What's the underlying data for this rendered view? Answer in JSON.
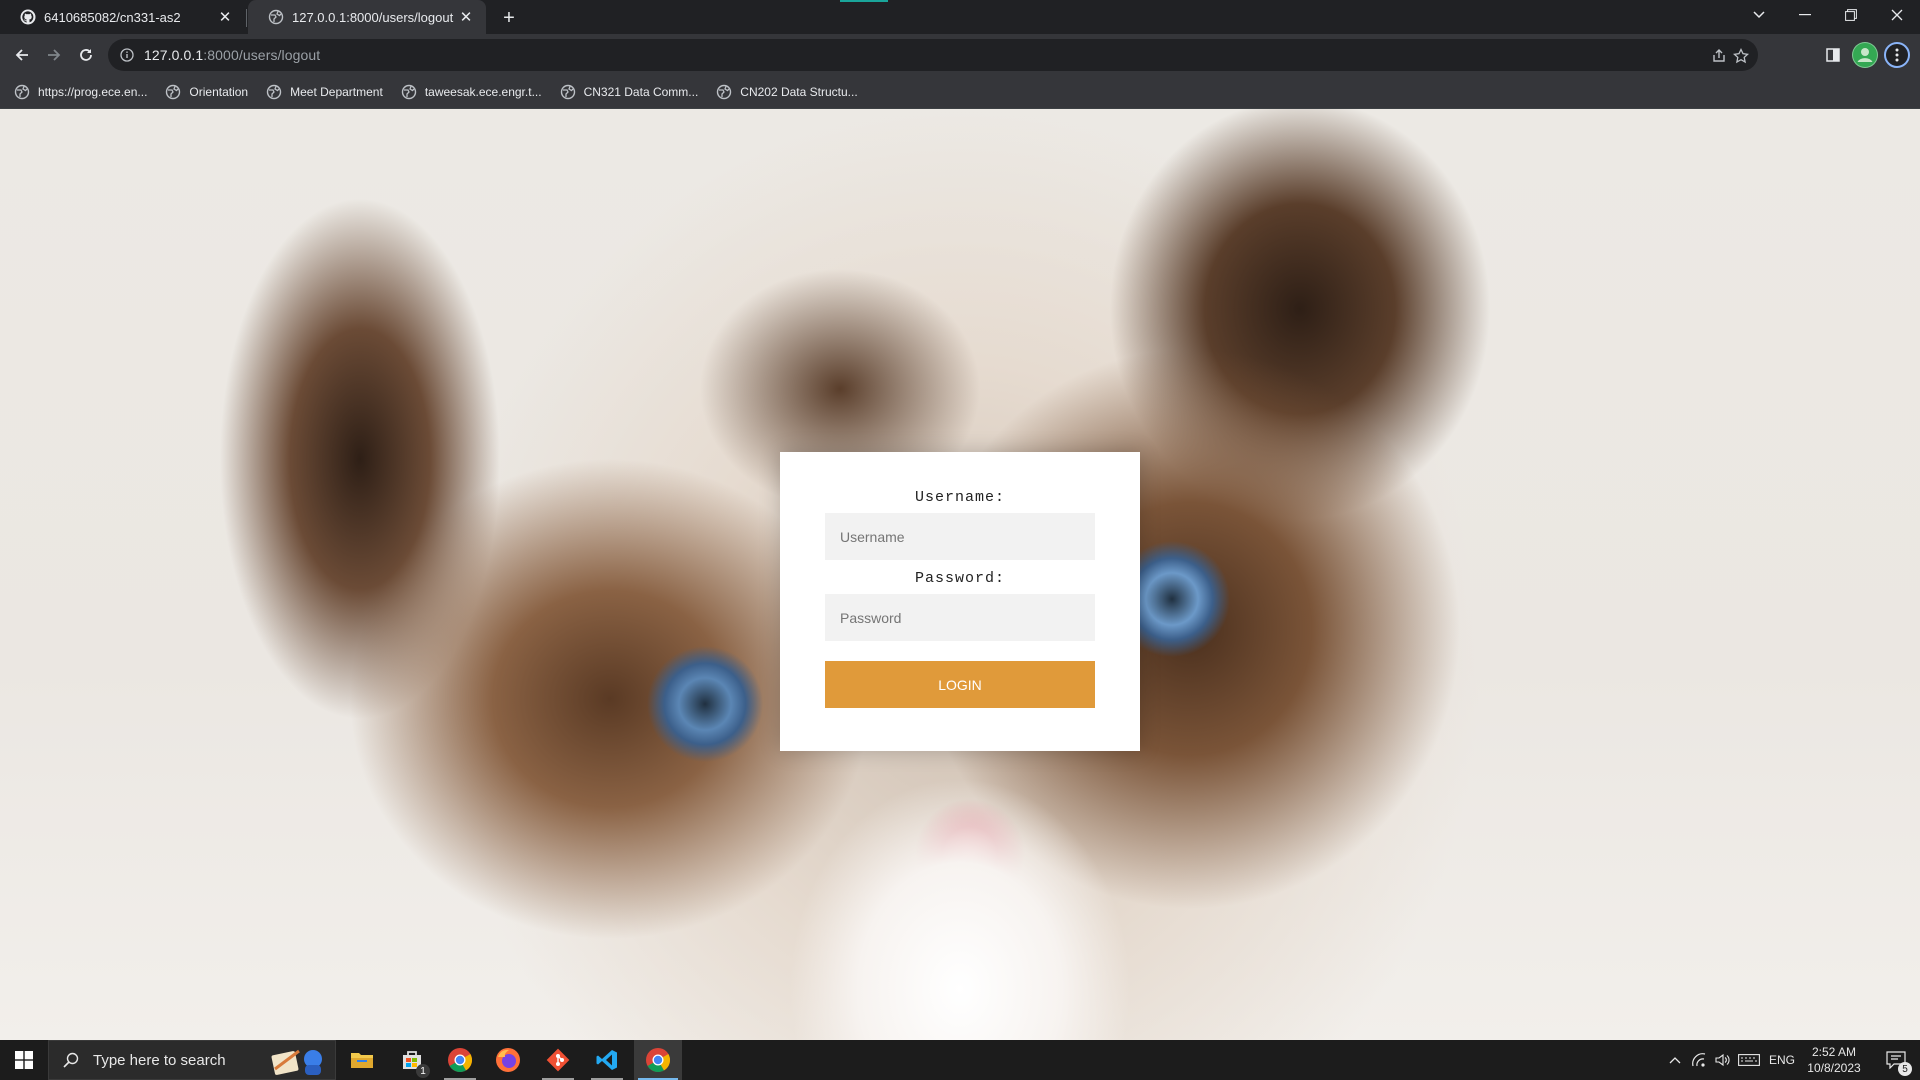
{
  "browser": {
    "tabs": [
      {
        "title": "6410685082/cn331-as2",
        "icon": "github-icon",
        "active": false
      },
      {
        "title": "127.0.0.1:8000/users/logout",
        "icon": "globe-icon",
        "active": true
      }
    ],
    "url": {
      "host": "127.0.0.1",
      "rest": ":8000/users/logout"
    },
    "bookmarks": [
      {
        "label": "https://prog.ece.en..."
      },
      {
        "label": "Orientation"
      },
      {
        "label": "Meet Department"
      },
      {
        "label": "taweesak.ece.engr.t..."
      },
      {
        "label": "CN321 Data Comm..."
      },
      {
        "label": "CN202 Data Structu..."
      }
    ]
  },
  "login": {
    "username_label": "Username:",
    "username_placeholder": "Username",
    "password_label": "Password:",
    "password_placeholder": "Password",
    "button_label": "LOGIN",
    "button_color": "#e09a3a",
    "background_image": "ragdoll-cat-closeup"
  },
  "taskbar": {
    "search_placeholder": "Type here to search",
    "apps": [
      "file-explorer-icon",
      "store-icon",
      "chrome-icon",
      "firefox-icon",
      "git-icon",
      "vscode-icon",
      "chrome-icon"
    ],
    "store_badge": "1",
    "language": "ENG",
    "time": "2:52 AM",
    "date": "10/8/2023",
    "notification_count": "5"
  }
}
